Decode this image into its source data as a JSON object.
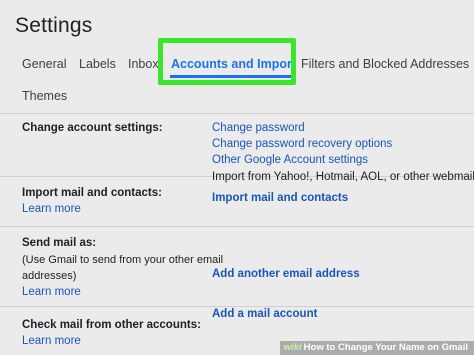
{
  "header": {
    "title": "Settings"
  },
  "tabs": [
    {
      "label": "General"
    },
    {
      "label": "Labels"
    },
    {
      "label": "Inbox"
    },
    {
      "label": "Accounts and Import",
      "active": true
    },
    {
      "label": "Filters and Blocked Addresses"
    },
    {
      "label": "Themes"
    }
  ],
  "colors": {
    "accent": "#1a73e8",
    "highlight": "#39e62a",
    "link": "#1a55b8"
  },
  "sections": {
    "change_account": {
      "label": "Change account settings:",
      "links": [
        "Change password",
        "Change password recovery options",
        "Other Google Account settings"
      ]
    },
    "import": {
      "label": "Import mail and contacts:",
      "learn_more": "Learn more",
      "description": "Import from Yahoo!, Hotmail, AOL, or other webmail",
      "action": "Import mail and contacts"
    },
    "send_as": {
      "label": "Send mail as:",
      "description_line1": "(Use Gmail to send from your other email",
      "description_line2": "addresses)",
      "learn_more": "Learn more",
      "action": "Add another email address"
    },
    "check_mail": {
      "label": "Check mail from other accounts:",
      "learn_more": "Learn more",
      "action": "Add a mail account"
    }
  },
  "watermark": {
    "logo": "wiki",
    "text": "How to Change Your Name on Gmail"
  }
}
